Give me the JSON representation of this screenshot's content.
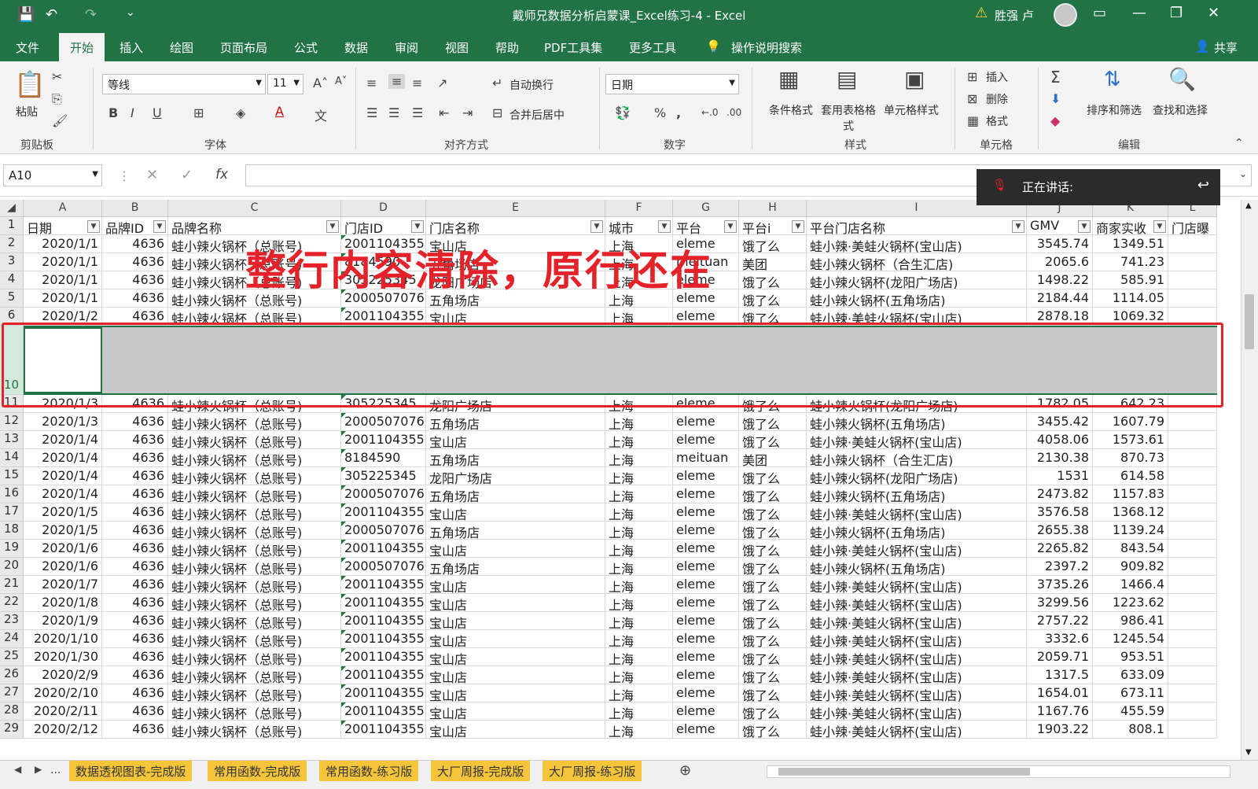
{
  "window": {
    "title": "戴师兄数据分析启蒙课_Excel练习-4 - Excel",
    "user": "胜强 卢"
  },
  "menu": {
    "tabs": [
      "文件",
      "开始",
      "插入",
      "绘图",
      "页面布局",
      "公式",
      "数据",
      "审阅",
      "视图",
      "帮助",
      "PDF工具集",
      "更多工具"
    ],
    "tell_me": "操作说明搜索",
    "share": "共享",
    "active_tab": "开始"
  },
  "ribbon": {
    "clipboard": {
      "label": "剪贴板",
      "paste": "粘贴"
    },
    "font": {
      "label": "字体",
      "name": "等线",
      "size": "11"
    },
    "alignment": {
      "label": "对齐方式",
      "wrap": "自动换行",
      "merge": "合并后居中"
    },
    "number": {
      "label": "数字",
      "format": "日期"
    },
    "styles": {
      "label": "样式",
      "cond": "条件格式",
      "table": "套用表格格式",
      "cell": "单元格样式"
    },
    "cells": {
      "label": "单元格",
      "insert": "插入",
      "delete": "删除",
      "format": "格式"
    },
    "editing": {
      "label": "编辑",
      "sort": "排序和筛选",
      "find": "查找和选择"
    }
  },
  "formula_bar": {
    "name_box": "A10",
    "fx": "fx"
  },
  "speaking": "正在讲话:",
  "columns": [
    "A",
    "B",
    "C",
    "D",
    "E",
    "F",
    "G",
    "H",
    "I",
    "J",
    "K",
    "L"
  ],
  "headers": [
    "日期",
    "品牌ID",
    "品牌名称",
    "门店ID",
    "门店名称",
    "城市",
    "平台",
    "平台i",
    "平台门店名称",
    "GMV",
    "商家实收",
    "门店曝"
  ],
  "rows": [
    {
      "n": "2",
      "c": [
        "2020/1/1",
        "4636",
        "蛙小辣火锅杯（总账号)",
        "2001104355",
        "宝山店",
        "上海",
        "eleme",
        "饿了么",
        "蛙小辣·美蛙火锅杯(宝山店)",
        "3545.74",
        "1349.51"
      ]
    },
    {
      "n": "3",
      "c": [
        "2020/1/1",
        "4636",
        "蛙小辣火锅杯（总账号)",
        "8184590",
        "五角场店",
        "上海",
        "meituan",
        "美团",
        "蛙小辣火锅杯（合生汇店)",
        "2065.6",
        "741.23"
      ]
    },
    {
      "n": "4",
      "c": [
        "2020/1/1",
        "4636",
        "蛙小辣火锅杯（总账号)",
        "305225345",
        "龙阳广场店",
        "上海",
        "eleme",
        "饿了么",
        "蛙小辣火锅杯(龙阳广场店)",
        "1498.22",
        "585.91"
      ]
    },
    {
      "n": "5",
      "c": [
        "2020/1/1",
        "4636",
        "蛙小辣火锅杯（总账号)",
        "2000507076",
        "五角场店",
        "上海",
        "eleme",
        "饿了么",
        "蛙小辣火锅杯(五角场店)",
        "2184.44",
        "1114.05"
      ]
    },
    {
      "n": "6",
      "c": [
        "2020/1/2",
        "4636",
        "蛙小辣火锅杯（总账号)",
        "2001104355",
        "宝山店",
        "上海",
        "eleme",
        "饿了么",
        "蛙小辣·美蛙火锅杯(宝山店)",
        "2878.18",
        "1069.32"
      ]
    },
    {
      "n": "11",
      "c": [
        "2020/1/3",
        "4636",
        "蛙小辣火锅杯（总账号)",
        "305225345",
        "龙阳广场店",
        "上海",
        "eleme",
        "饿了么",
        "蛙小辣火锅杯(龙阳广场店)",
        "1782.05",
        "642.23"
      ]
    },
    {
      "n": "12",
      "c": [
        "2020/1/3",
        "4636",
        "蛙小辣火锅杯（总账号)",
        "2000507076",
        "五角场店",
        "上海",
        "eleme",
        "饿了么",
        "蛙小辣火锅杯(五角场店)",
        "3455.42",
        "1607.79"
      ]
    },
    {
      "n": "13",
      "c": [
        "2020/1/4",
        "4636",
        "蛙小辣火锅杯（总账号)",
        "2001104355",
        "宝山店",
        "上海",
        "eleme",
        "饿了么",
        "蛙小辣·美蛙火锅杯(宝山店)",
        "4058.06",
        "1573.61"
      ]
    },
    {
      "n": "14",
      "c": [
        "2020/1/4",
        "4636",
        "蛙小辣火锅杯（总账号)",
        "8184590",
        "五角场店",
        "上海",
        "meituan",
        "美团",
        "蛙小辣火锅杯（合生汇店)",
        "2130.38",
        "870.73"
      ]
    },
    {
      "n": "15",
      "c": [
        "2020/1/4",
        "4636",
        "蛙小辣火锅杯（总账号)",
        "305225345",
        "龙阳广场店",
        "上海",
        "eleme",
        "饿了么",
        "蛙小辣火锅杯(龙阳广场店)",
        "1531",
        "614.58"
      ]
    },
    {
      "n": "16",
      "c": [
        "2020/1/4",
        "4636",
        "蛙小辣火锅杯（总账号)",
        "2000507076",
        "五角场店",
        "上海",
        "eleme",
        "饿了么",
        "蛙小辣火锅杯(五角场店)",
        "2473.82",
        "1157.83"
      ]
    },
    {
      "n": "17",
      "c": [
        "2020/1/5",
        "4636",
        "蛙小辣火锅杯（总账号)",
        "2001104355",
        "宝山店",
        "上海",
        "eleme",
        "饿了么",
        "蛙小辣·美蛙火锅杯(宝山店)",
        "3576.58",
        "1368.12"
      ]
    },
    {
      "n": "18",
      "c": [
        "2020/1/5",
        "4636",
        "蛙小辣火锅杯（总账号)",
        "2000507076",
        "五角场店",
        "上海",
        "eleme",
        "饿了么",
        "蛙小辣火锅杯(五角场店)",
        "2655.38",
        "1139.24"
      ]
    },
    {
      "n": "19",
      "c": [
        "2020/1/6",
        "4636",
        "蛙小辣火锅杯（总账号)",
        "2001104355",
        "宝山店",
        "上海",
        "eleme",
        "饿了么",
        "蛙小辣·美蛙火锅杯(宝山店)",
        "2265.82",
        "843.54"
      ]
    },
    {
      "n": "20",
      "c": [
        "2020/1/6",
        "4636",
        "蛙小辣火锅杯（总账号)",
        "2000507076",
        "五角场店",
        "上海",
        "eleme",
        "饿了么",
        "蛙小辣火锅杯(五角场店)",
        "2397.2",
        "909.82"
      ]
    },
    {
      "n": "21",
      "c": [
        "2020/1/7",
        "4636",
        "蛙小辣火锅杯（总账号)",
        "2001104355",
        "宝山店",
        "上海",
        "eleme",
        "饿了么",
        "蛙小辣·美蛙火锅杯(宝山店)",
        "3735.26",
        "1466.4"
      ]
    },
    {
      "n": "22",
      "c": [
        "2020/1/8",
        "4636",
        "蛙小辣火锅杯（总账号)",
        "2001104355",
        "宝山店",
        "上海",
        "eleme",
        "饿了么",
        "蛙小辣·美蛙火锅杯(宝山店)",
        "3299.56",
        "1223.62"
      ]
    },
    {
      "n": "23",
      "c": [
        "2020/1/9",
        "4636",
        "蛙小辣火锅杯（总账号)",
        "2001104355",
        "宝山店",
        "上海",
        "eleme",
        "饿了么",
        "蛙小辣·美蛙火锅杯(宝山店)",
        "2757.22",
        "986.41"
      ]
    },
    {
      "n": "24",
      "c": [
        "2020/1/10",
        "4636",
        "蛙小辣火锅杯（总账号)",
        "2001104355",
        "宝山店",
        "上海",
        "eleme",
        "饿了么",
        "蛙小辣·美蛙火锅杯(宝山店)",
        "3332.6",
        "1245.54"
      ]
    },
    {
      "n": "25",
      "c": [
        "2020/1/30",
        "4636",
        "蛙小辣火锅杯（总账号)",
        "2001104355",
        "宝山店",
        "上海",
        "eleme",
        "饿了么",
        "蛙小辣·美蛙火锅杯(宝山店)",
        "2059.71",
        "953.51"
      ]
    },
    {
      "n": "26",
      "c": [
        "2020/2/9",
        "4636",
        "蛙小辣火锅杯（总账号)",
        "2001104355",
        "宝山店",
        "上海",
        "eleme",
        "饿了么",
        "蛙小辣·美蛙火锅杯(宝山店)",
        "1317.5",
        "633.09"
      ]
    },
    {
      "n": "27",
      "c": [
        "2020/2/10",
        "4636",
        "蛙小辣火锅杯（总账号)",
        "2001104355",
        "宝山店",
        "上海",
        "eleme",
        "饿了么",
        "蛙小辣·美蛙火锅杯(宝山店)",
        "1654.01",
        "673.11"
      ]
    },
    {
      "n": "28",
      "c": [
        "2020/2/11",
        "4636",
        "蛙小辣火锅杯（总账号)",
        "2001104355",
        "宝山店",
        "上海",
        "eleme",
        "饿了么",
        "蛙小辣·美蛙火锅杯(宝山店)",
        "1167.76",
        "455.59"
      ]
    },
    {
      "n": "29",
      "c": [
        "2020/2/12",
        "4636",
        "蛙小辣火锅杯（总账号)",
        "2001104355",
        "宝山店",
        "上海",
        "eleme",
        "饿了么",
        "蛙小辣·美蛙火锅杯(宝山店)",
        "1903.22",
        "808.1"
      ]
    }
  ],
  "annotation": "整行内容清除，原行还在",
  "selected_row": "10",
  "sheet_tabs": [
    "数据透视图表-完成版",
    "常用函数-完成版",
    "常用函数-练习版",
    "大厂周报-完成版",
    "大厂周报-练习版"
  ],
  "sheet_nav": "...",
  "colors": {
    "excel_green": "#217346",
    "annotation_red": "#e3222a",
    "sheet_tab": "#f4c43a"
  }
}
